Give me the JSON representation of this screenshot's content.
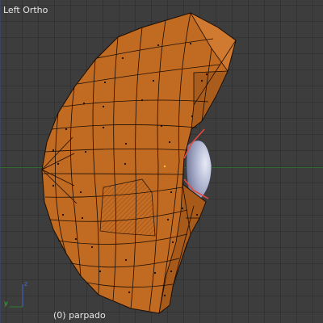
{
  "viewport": {
    "view_name": "Left Ortho",
    "object_info": "(0) parpado"
  },
  "gizmo": {
    "up_axis": "z",
    "side_axis": "y",
    "up_color": "#3d6bd6",
    "side_color": "#40c040"
  },
  "mesh": {
    "face_color": "#c06a22",
    "face_selected_color": "#d3833a",
    "edge_color": "#1b0d02",
    "selected_edge_color": "#e34a40",
    "eye_color": "#9fa6c4"
  }
}
